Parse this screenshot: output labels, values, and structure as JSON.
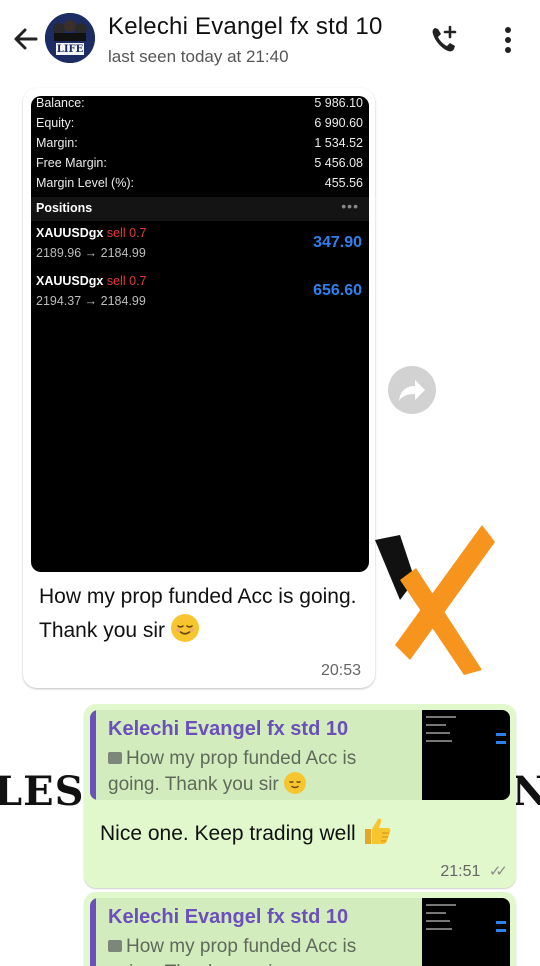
{
  "header": {
    "name": "Kelechi Evangel fx std 10",
    "status": "last seen today at 21:40",
    "avatar_text": "LIFE"
  },
  "background": {
    "left_text": "LES",
    "right_text": "N"
  },
  "incoming": {
    "account": [
      {
        "label": "Balance:",
        "value": "5 986.10"
      },
      {
        "label": "Equity:",
        "value": "6 990.60"
      },
      {
        "label": "Margin:",
        "value": "1 534.52"
      },
      {
        "label": "Free Margin:",
        "value": "5 456.08"
      },
      {
        "label": "Margin Level (%):",
        "value": "455.56"
      }
    ],
    "positions_title": "Positions",
    "positions_more": "•••",
    "positions": [
      {
        "symbol": "XAUUSDgx",
        "side": "sell 0.7",
        "prices": "2189.96 → 2184.99",
        "profit": "347.90"
      },
      {
        "symbol": "XAUUSDgx",
        "side": "sell 0.7",
        "prices": "2194.37 → 2184.99",
        "profit": "656.60"
      }
    ],
    "caption": "How my prop funded Acc is going. Thank you sir",
    "time": "20:53"
  },
  "outgoing": [
    {
      "quote_name": "Kelechi Evangel fx std 10",
      "quote_text": "How my prop funded Acc is going. Thank you sir",
      "text": "Nice one. Keep trading well",
      "time": "21:51",
      "ticks": "✓✓"
    },
    {
      "quote_name": "Kelechi Evangel fx std 10",
      "quote_text": "How my prop funded Acc is going. Thank you sir"
    }
  ],
  "colors": {
    "accent": "#6b4fbb",
    "outgoing_bubble": "#e1f8cd",
    "profit": "#2f80ed",
    "sell": "#e53935",
    "emoji": "#f7c62f"
  },
  "icons": [
    "back-arrow-icon",
    "add-call-icon",
    "more-vert-icon",
    "forward-icon",
    "photo-icon",
    "relieved-face-emoji",
    "thumbs-up-emoji",
    "double-check-icon"
  ]
}
